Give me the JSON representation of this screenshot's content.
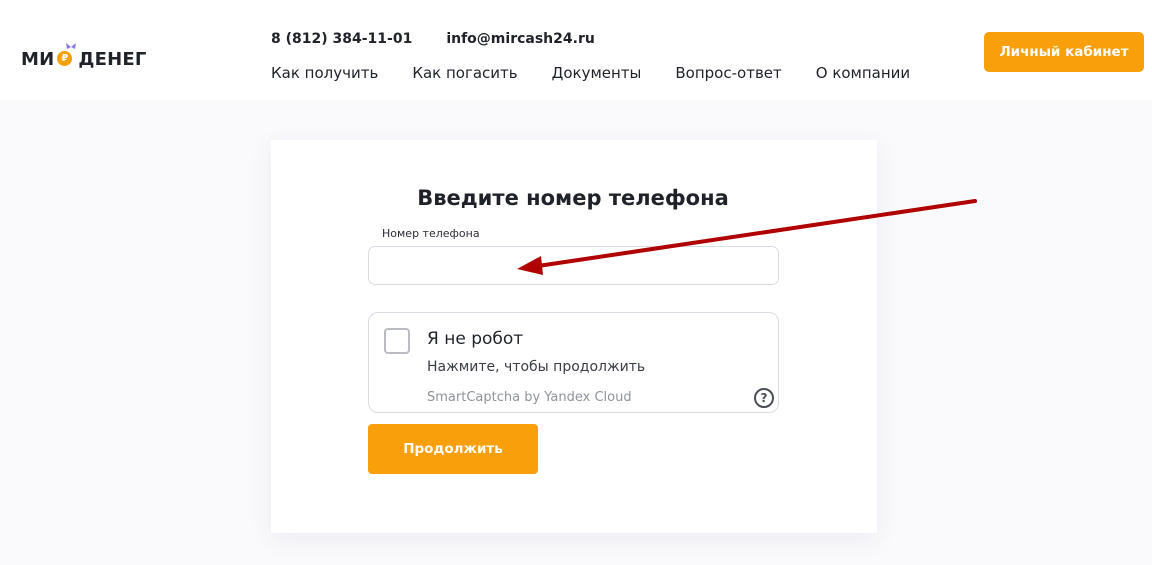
{
  "header": {
    "logo": {
      "part1": "МИ",
      "coin_symbol": "₽",
      "part2": "ДЕНЕГ"
    },
    "phone": "8 (812) 384-11-01",
    "email": "info@mircash24.ru",
    "nav": [
      "Как получить",
      "Как погасить",
      "Документы",
      "Вопрос-ответ",
      "О компании"
    ],
    "cabinet_button": "Личный кабинет"
  },
  "form": {
    "title": "Введите номер телефона",
    "phone_label": "Номер телефона",
    "phone_value": "",
    "captcha": {
      "title": "Я не робот",
      "subtitle": "Нажмите, чтобы продолжить",
      "brand": "SmartCaptcha by Yandex Cloud",
      "help_symbol": "?"
    },
    "continue_button": "Продолжить"
  },
  "colors": {
    "accent": "#f99f0c",
    "annotation_arrow": "#b00000"
  },
  "icons": [
    "coin-icon",
    "checkbox-icon",
    "help-icon",
    "annotation-arrow"
  ]
}
